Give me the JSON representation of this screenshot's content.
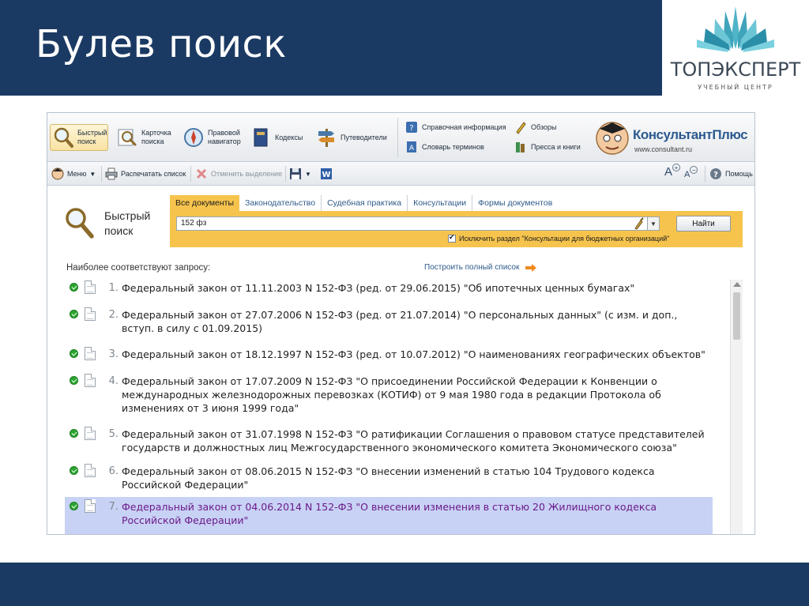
{
  "slide": {
    "title": "Булев поиск",
    "brand_name": "ТОПЭКСПЕРТ",
    "brand_sub": "УЧЕБНЫЙ ЦЕНТР",
    "header_color": "#1b3a63"
  },
  "ribbon": {
    "quick_search": "Быстрый поиск",
    "card_search": "Карточка поиска",
    "legal_nav": "Правовой навигатор",
    "codes": "Кодексы",
    "guides": "Путеводители",
    "reference": "Справочная информация",
    "glossary": "Словарь терминов",
    "reviews": "Обзоры",
    "press": "Пресса и книги",
    "kp_name": "КонсультантПлюс",
    "kp_url": "www.consultant.ru"
  },
  "toolbar": {
    "menu": "Меню",
    "print": "Распечатать список",
    "unselect": "Отменить выделение",
    "font_up": "A",
    "font_down": "A",
    "help": "Помощь"
  },
  "search": {
    "title": "Быстрый поиск",
    "tabs": [
      "Все документы",
      "Законодательство",
      "Судебная практика",
      "Консультации",
      "Формы документов"
    ],
    "active_tab": 0,
    "query": "152 фз",
    "button": "Найти",
    "checkbox_label": "Исключить раздел \"Консультации для бюджетных организаций\"",
    "checkbox_checked": true
  },
  "results": {
    "heading": "Наиболее соответствуют запросу:",
    "full_list_link": "Построить полный список",
    "items": [
      {
        "num": "1.",
        "text": "Федеральный закон от 11.11.2003 N 152-ФЗ (ред. от 29.06.2015) \"Об ипотечных ценных бумагах\""
      },
      {
        "num": "2.",
        "text": "Федеральный закон от 27.07.2006 N 152-ФЗ (ред. от 21.07.2014) \"О персональных данных\" (с изм. и доп., вступ. в силу с 01.09.2015)"
      },
      {
        "num": "3.",
        "text": "Федеральный закон от 18.12.1997 N 152-ФЗ (ред. от 10.07.2012) \"О наименованиях географических объектов\""
      },
      {
        "num": "4.",
        "text": "Федеральный закон от 17.07.2009 N 152-ФЗ \"О присоединении Российской Федерации к Конвенции о международных железнодорожных перевозках (КОТИФ) от 9 мая 1980 года в редакции Протокола об изменениях от 3 июня 1999 года\""
      },
      {
        "num": "5.",
        "text": "Федеральный закон от 31.07.1998 N 152-ФЗ \"О ратификации Соглашения о правовом статусе представителей государств и должностных лиц Межгосударственного экономического комитета Экономического союза\""
      },
      {
        "num": "6.",
        "text": "Федеральный закон от 08.06.2015 N 152-ФЗ \"О внесении изменений в статью 104 Трудового кодекса Российской Федерации\""
      },
      {
        "num": "7.",
        "text": "Федеральный закон от 04.06.2014 N 152-ФЗ \"О внесении изменения в статью 20 Жилищного кодекса Российской Федерации\""
      }
    ],
    "selected_index": 6
  }
}
